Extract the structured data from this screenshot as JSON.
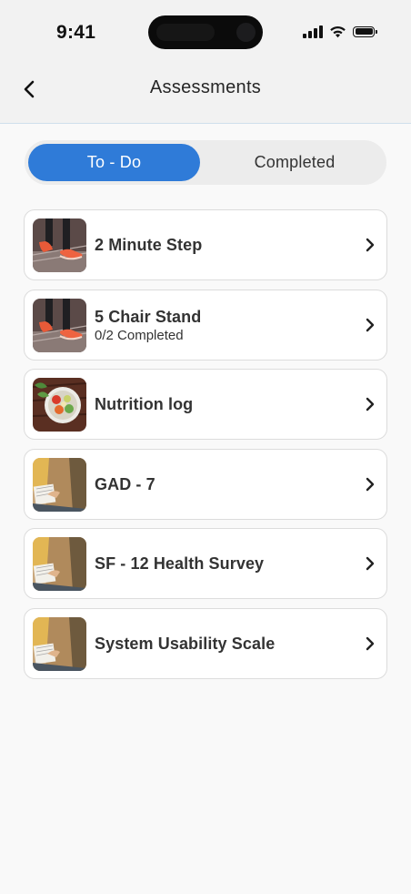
{
  "status_bar": {
    "time": "9:41"
  },
  "nav": {
    "title": "Assessments"
  },
  "tabs": [
    {
      "label": "To - Do",
      "active": true
    },
    {
      "label": "Completed",
      "active": false
    }
  ],
  "accent_color": "#2f7bd8",
  "assessments": [
    {
      "title": "2 Minute Step",
      "subtitle": "",
      "thumbnail": "sneakers-photo"
    },
    {
      "title": "5 Chair Stand",
      "subtitle": "0/2 Completed",
      "thumbnail": "sneakers-photo"
    },
    {
      "title": "Nutrition log",
      "subtitle": "",
      "thumbnail": "salad-bowl-photo"
    },
    {
      "title": "GAD - 7",
      "subtitle": "",
      "thumbnail": "person-writing-photo"
    },
    {
      "title": "SF - 12 Health Survey",
      "subtitle": "",
      "thumbnail": "person-writing-photo"
    },
    {
      "title": "System Usability Scale",
      "subtitle": "",
      "thumbnail": "person-writing-photo"
    }
  ]
}
